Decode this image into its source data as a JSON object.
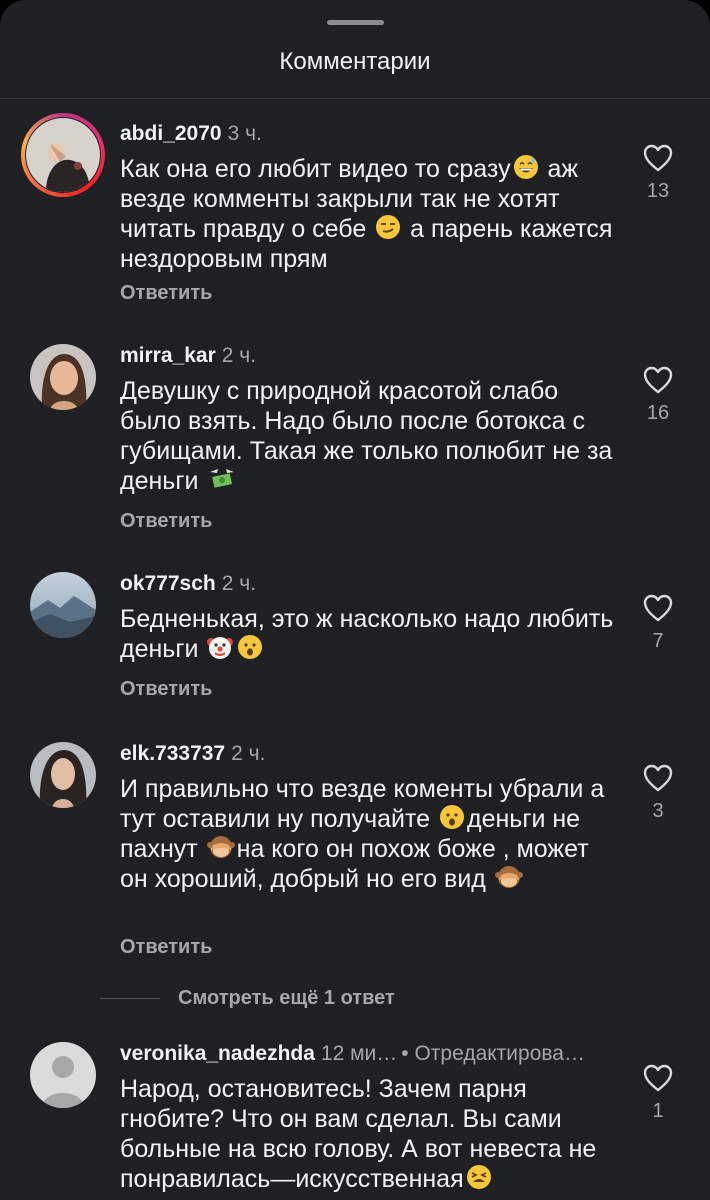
{
  "header": {
    "title": "Комментарии"
  },
  "comments": [
    {
      "username": "abdi_2070",
      "time": "3 ч.",
      "text_parts": [
        "Как она его любит видео то сразу",
        " аж везде комменты закрыли так не хотят читать правду о себе ",
        " а парень кажется нездоровым прям"
      ],
      "likes": "13",
      "reply": "Ответить"
    },
    {
      "username": "mirra_kar",
      "time": "2 ч.",
      "text_parts": [
        "Девушку с природной красотой слабо было взять. Надо было после ботокса с губищами. Такая же только полюбит не за деньги "
      ],
      "likes": "16",
      "reply": "Ответить"
    },
    {
      "username": "ok777sch",
      "time": "2 ч.",
      "text_parts": [
        "Бедненькая, это ж насколько надо любить деньги "
      ],
      "likes": "7",
      "reply": "Ответить"
    },
    {
      "username": "elk.733737",
      "time": "2 ч.",
      "text_parts": [
        "И правильно что везде коменты убрали а тут оставили ну получайте ",
        "деньги не пахнут ",
        "на кого он похож боже , может он хороший, добрый но его вид "
      ],
      "likes": "3",
      "reply": "Ответить"
    },
    {
      "username": "veronika_nadezhda",
      "time": "12 ми…",
      "edited": "• Отредактирова…",
      "text_parts": [
        "Народ, остановитесь! Зачем парня гнобите? Что он вам сделал. Вы сами больные на всю голову. А вот невеста не понравилась—искусственная"
      ],
      "likes": "1"
    }
  ],
  "more_replies": "Смотреть ещё 1 ответ",
  "colors": {
    "background": "#1f2023",
    "text": "#f2f2f2",
    "muted": "#a6a7ab"
  }
}
